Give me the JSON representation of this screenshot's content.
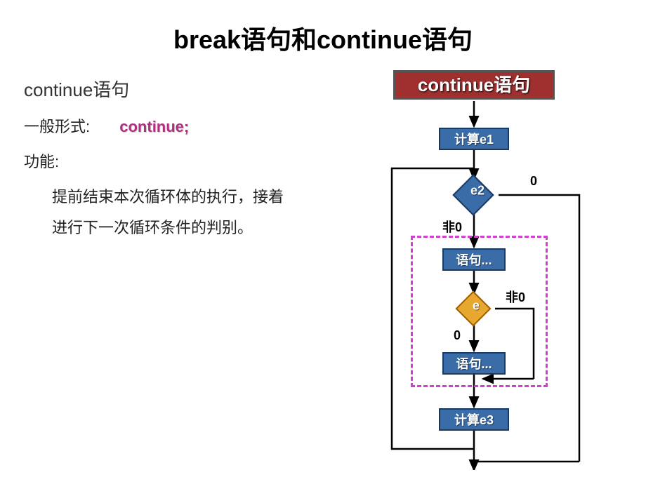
{
  "title": "break语句和continue语句",
  "subtitle": "continue语句",
  "form_label": "一般形式:",
  "keyword": "continue;",
  "func_label": "功能:",
  "desc_line1": "提前结束本次循环体的执行，接着",
  "desc_line2": "进行下一次循环条件的判别。",
  "flow": {
    "header": "continue语句",
    "step1": "计算e1",
    "cond1": "e2",
    "cond1_true": "非0",
    "cond1_false": "0",
    "stmt1": "语句...",
    "cond2": "e",
    "cond2_true": "非0",
    "cond2_false": "0",
    "stmt2": "语句...",
    "step3": "计算e3"
  }
}
